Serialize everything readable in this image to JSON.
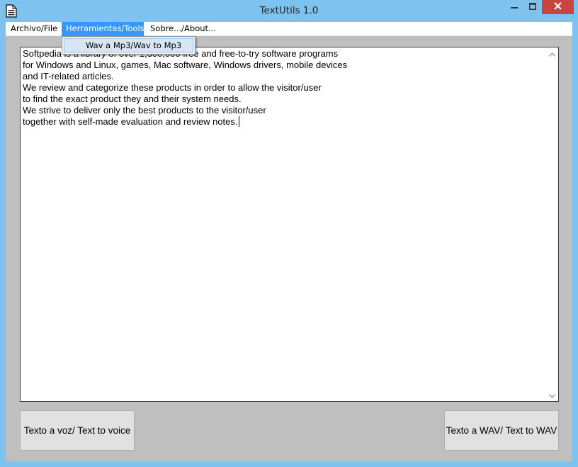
{
  "window": {
    "title": "TextUtils 1.0",
    "app_icon": "document-icon",
    "controls": {
      "minimize_icon": "minimize-icon",
      "maximize_icon": "maximize-icon",
      "close_icon": "close-icon"
    }
  },
  "menubar": {
    "items": [
      {
        "label": "Archivo/File"
      },
      {
        "label": "Herramientas/Tools",
        "active": true
      },
      {
        "label": "Sobre.../About..."
      }
    ]
  },
  "dropdown": {
    "items": [
      {
        "label": "Wav a Mp3/Wav to Mp3",
        "highlighted": true
      }
    ]
  },
  "editor": {
    "lines": [
      "Softpedia is a library of over 1,300,000 free and free-to-try software programs",
      "for Windows and Linux, games, Mac software, Windows drivers, mobile devices",
      "and IT-related articles.",
      "",
      "We review and categorize these products in order to allow the visitor/user",
      "to find the exact product they and their system needs.",
      "",
      "We strive to deliver only the best products to the visitor/user",
      "together with self-made evaluation and review notes."
    ]
  },
  "buttons": {
    "text_to_voice": "Texto a voz/ Text to voice",
    "text_to_wav": "Texto a WAV/ Text to WAV"
  },
  "colors": {
    "title_bar": "#7ec2ef",
    "close_button": "#c7463f",
    "menu_highlight": "#3399ff",
    "client_background": "#bfbfbf"
  }
}
